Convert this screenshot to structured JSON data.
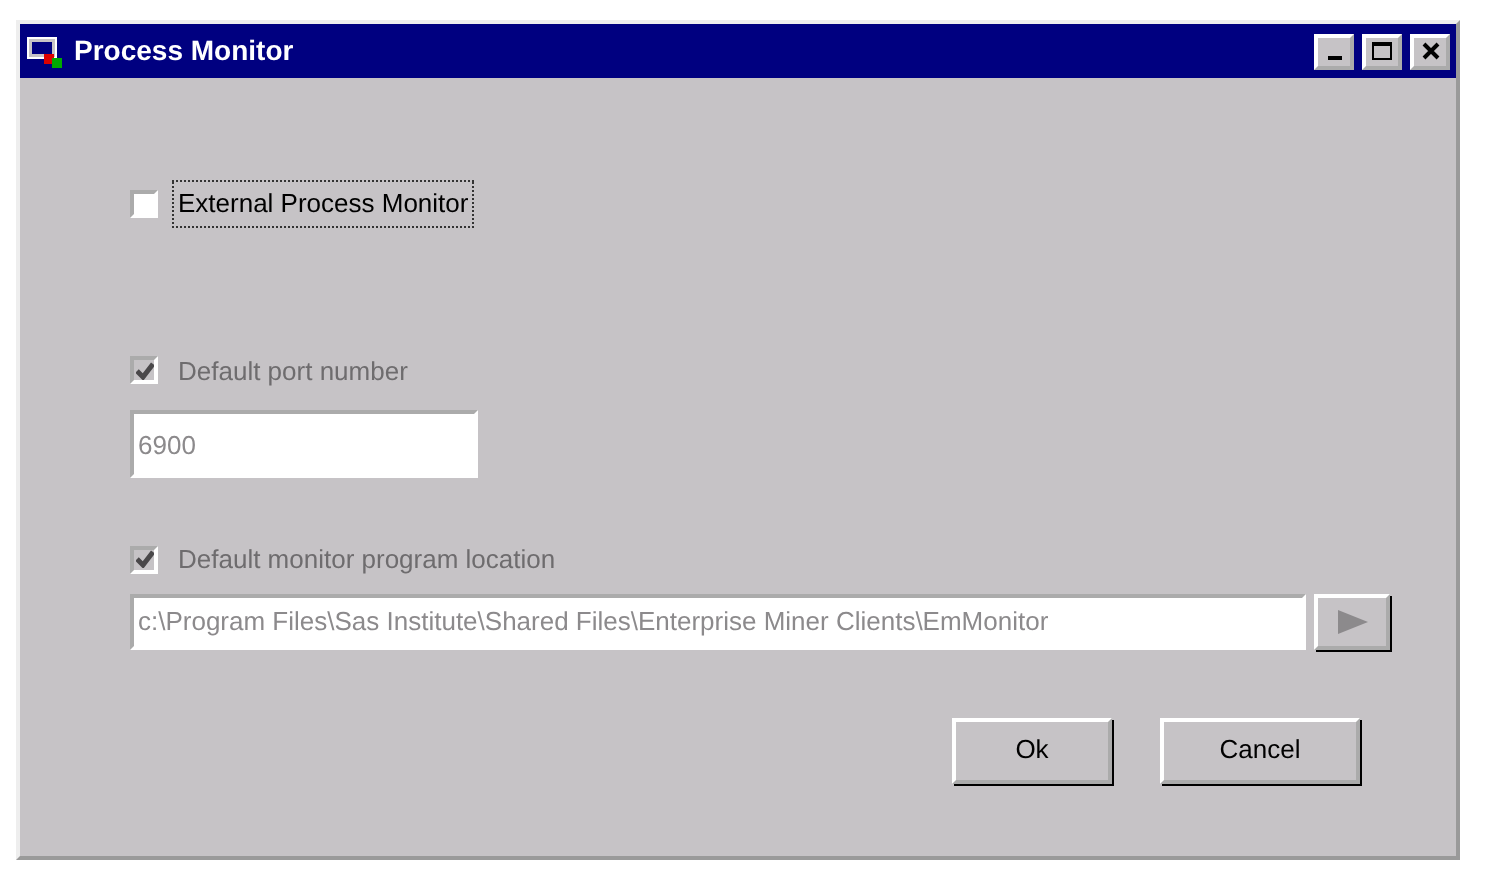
{
  "window": {
    "title": "Process Monitor"
  },
  "external_monitor": {
    "label": "External Process Monitor",
    "checked": false,
    "disabled": false,
    "focused": true
  },
  "port": {
    "label": "Default port number",
    "checked": true,
    "disabled": true,
    "value": "6900"
  },
  "location": {
    "label": "Default monitor program location",
    "checked": true,
    "disabled": true,
    "value": "c:\\Program Files\\Sas Institute\\Shared Files\\Enterprise Miner Clients\\EmMonitor"
  },
  "buttons": [
    {
      "label": "Ok"
    },
    {
      "label": "Cancel"
    }
  ]
}
